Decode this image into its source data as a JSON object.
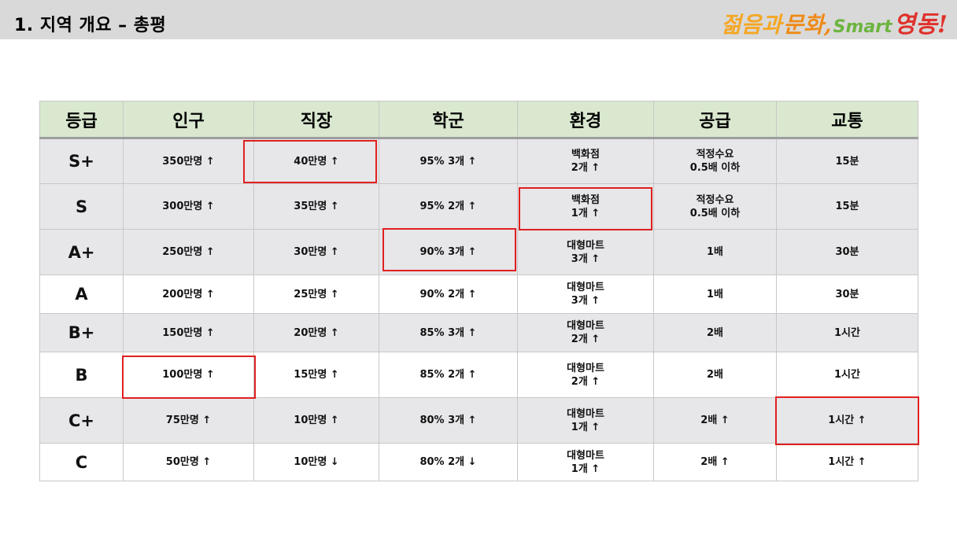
{
  "header": {
    "title": "1. 지역 개요 – 총평",
    "logo": {
      "part1": "젊음과",
      "part2": "문화,",
      "part3": "Smart",
      "part4": "영동!"
    }
  },
  "table": {
    "columns": [
      "등급",
      "인구",
      "직장",
      "학군",
      "환경",
      "공급",
      "교통"
    ],
    "rows": [
      {
        "grade": "S+",
        "population": "350만명 ↑",
        "jobs": "40만명 ↑",
        "school": "95% 3개 ↑",
        "environment": "백화점\n2개 ↑",
        "supply": "적정수요\n0.5배 이하",
        "transport": "15분"
      },
      {
        "grade": "S",
        "population": "300만명 ↑",
        "jobs": "35만명 ↑",
        "school": "95% 2개 ↑",
        "environment": "백화점\n1개 ↑",
        "supply": "적정수요\n0.5배 이하",
        "transport": "15분"
      },
      {
        "grade": "A+",
        "population": "250만명 ↑",
        "jobs": "30만명 ↑",
        "school": "90% 3개 ↑",
        "environment": "대형마트\n3개 ↑",
        "supply": "1배",
        "transport": "30분"
      },
      {
        "grade": "A",
        "population": "200만명 ↑",
        "jobs": "25만명 ↑",
        "school": "90% 2개 ↑",
        "environment": "대형마트\n3개 ↑",
        "supply": "1배",
        "transport": "30분"
      },
      {
        "grade": "B+",
        "population": "150만명 ↑",
        "jobs": "20만명 ↑",
        "school": "85% 3개 ↑",
        "environment": "대형마트\n2개 ↑",
        "supply": "2배",
        "transport": "1시간"
      },
      {
        "grade": "B",
        "population": "100만명 ↑",
        "jobs": "15만명 ↑",
        "school": "85% 2개 ↑",
        "environment": "대형마트\n2개 ↑",
        "supply": "2배",
        "transport": "1시간"
      },
      {
        "grade": "C+",
        "population": "75만명 ↑",
        "jobs": "10만명 ↑",
        "school": "80% 3개 ↑",
        "environment": "대형마트\n1개 ↑",
        "supply": "2배 ↑",
        "transport": "1시간 ↑"
      },
      {
        "grade": "C",
        "population": "50만명 ↑",
        "jobs": "10만명 ↓",
        "school": "80% 2개 ↓",
        "environment": "대형마트\n1개 ↑",
        "supply": "2배 ↑",
        "transport": "1시간 ↑"
      }
    ]
  },
  "highlight_color": "#e02020"
}
